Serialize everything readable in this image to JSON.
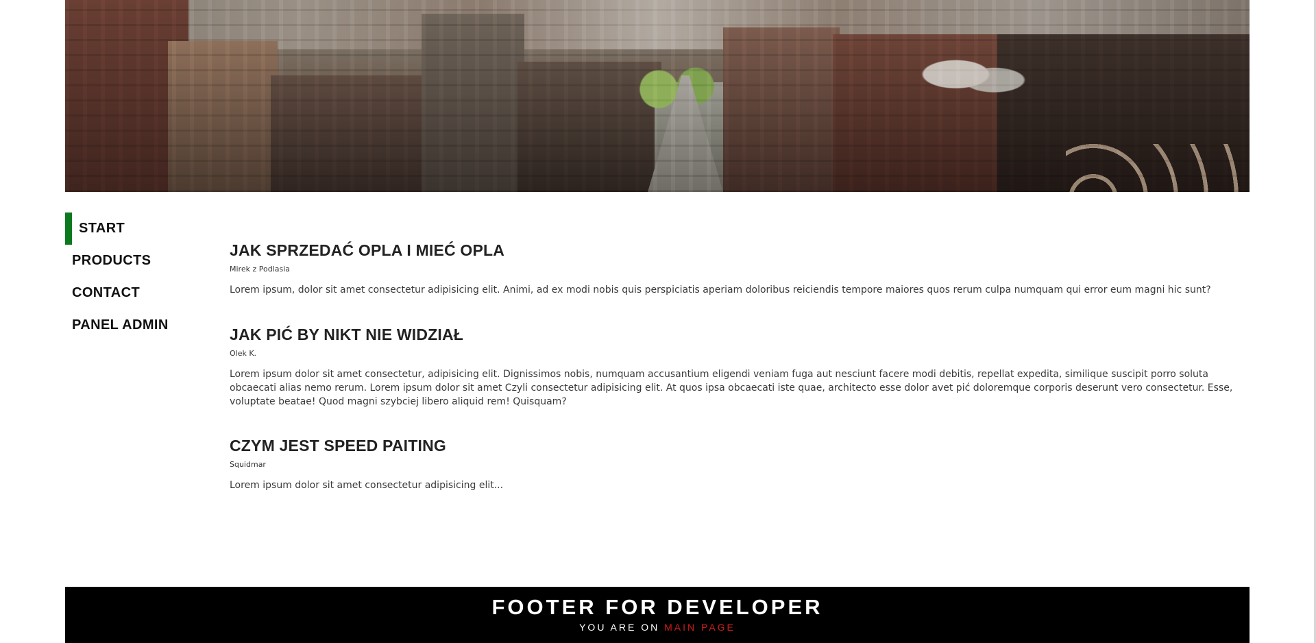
{
  "header": {
    "image_alt": "City street panorama with brick buildings"
  },
  "nav": {
    "items": [
      {
        "label": "START",
        "active": true
      },
      {
        "label": "PRODUCTS",
        "active": false
      },
      {
        "label": "CONTACT",
        "active": false
      },
      {
        "label": "PANEL ADMIN",
        "active": false
      }
    ]
  },
  "articles": [
    {
      "title": "JAK SPRZEDAĆ OPLA I MIEĆ OPLA",
      "author": "Mirek z Podlasia",
      "body": "Lorem ipsum, dolor sit amet consectetur adipisicing elit. Animi, ad ex modi nobis quis perspiciatis aperiam doloribus reiciendis tempore maiores quos rerum culpa numquam qui error eum magni hic sunt?"
    },
    {
      "title": "JAK PIĆ BY NIKT NIE WIDZIAŁ",
      "author": "Olek K.",
      "body": "Lorem ipsum dolor sit amet consectetur, adipisicing elit. Dignissimos nobis, numquam accusantium eligendi veniam fuga aut nesciunt facere modi debitis, repellat expedita, similique suscipit porro soluta obcaecati alias nemo rerum. Lorem ipsum dolor sit amet Czyli consectetur adipisicing elit. At quos ipsa obcaecati iste quae, architecto esse dolor avet pić doloremque corporis deserunt vero consectetur. Esse, voluptate beatae! Quod magni szybciej libero aliquid rem! Quisquam?"
    },
    {
      "title": "CZYM JEST SPEED PAITING",
      "author": "Squidmar",
      "body": "Lorem ipsum dolor sit amet consectetur adipisicing elit..."
    }
  ],
  "footer": {
    "title": "FOOTER FOR DEVELOPER",
    "subtitle_prefix": "YOU ARE ON",
    "subtitle_accent": "MAIN PAGE"
  },
  "colors": {
    "nav_active_bar": "#0b7a1f",
    "footer_bg": "#000000",
    "footer_accent": "#d31a1a"
  }
}
